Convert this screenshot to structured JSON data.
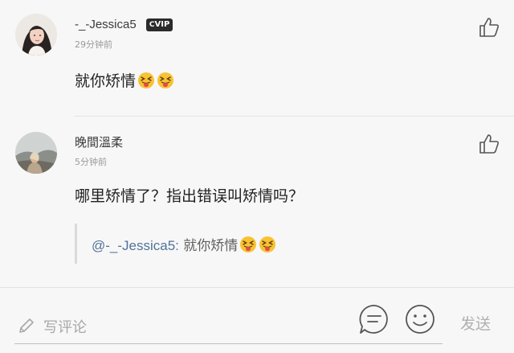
{
  "comments": [
    {
      "username": "-_-Jessica5",
      "badge": "VIP",
      "time": "29分钟前",
      "text": "就你矫情",
      "emojis": [
        "squint-tongue-emoji",
        "squint-tongue-emoji"
      ]
    },
    {
      "username": "晚間溫柔",
      "time": "5分钟前",
      "text": "哪里矫情了？指出错误叫矫情吗？",
      "quote": {
        "user": "@-_-Jessica5:",
        "text": " 就你矫情",
        "emojis": [
          "squint-tongue-emoji",
          "squint-tongue-emoji"
        ]
      }
    }
  ],
  "bottom_bar": {
    "placeholder": "写评论",
    "send_label": "发送",
    "icons": [
      "pencil-icon",
      "comment-list-icon",
      "smiley-icon"
    ]
  },
  "colors": {
    "background": "#f7f7f7",
    "mention": "#50739a",
    "emoji_face": "#f9c232",
    "emoji_tongue": "#e5484d"
  }
}
